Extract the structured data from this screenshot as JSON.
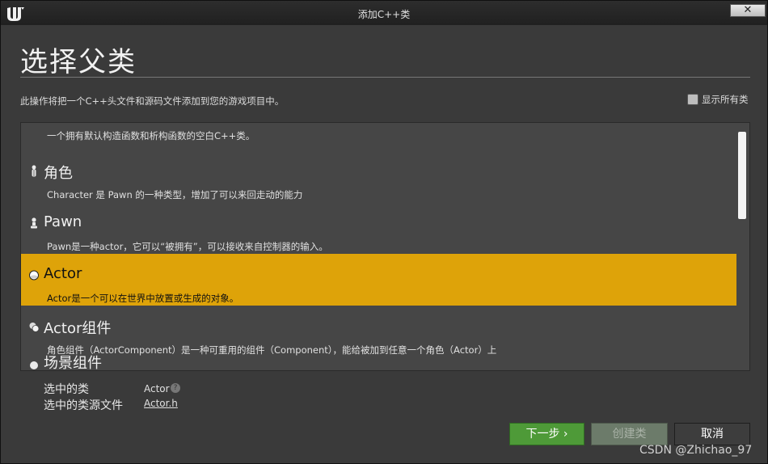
{
  "window": {
    "title": "添加C++类",
    "close_label": "✕"
  },
  "heading": "选择父类",
  "description": "此操作将把一个C++头文件和源码文件添加到您的游戏项目中。",
  "show_all": {
    "label": "显示所有类",
    "checked": false
  },
  "list": {
    "top_partial_desc": "一个拥有默认构造函数和析构函数的空白C++类。",
    "items": [
      {
        "name": "角色",
        "desc": "Character 是 Pawn 的一种类型，增加了可以来回走动的能力",
        "icon": "character-icon",
        "selected": false
      },
      {
        "name": "Pawn",
        "desc": "Pawn是一种actor，它可以“被拥有”，可以接收来自控制器的输入。",
        "icon": "pawn-icon",
        "selected": false
      },
      {
        "name": "Actor",
        "desc": "Actor是一个可以在世界中放置或生成的对象。",
        "icon": "actor-icon",
        "selected": true
      },
      {
        "name": "Actor组件",
        "desc": "角色组件（ActorComponent）是一种可重用的组件（Component），能给被加到任意一个角色（Actor）上",
        "icon": "actor-component-icon",
        "selected": false
      }
    ],
    "cut_item_name": "场景组件"
  },
  "selected_info": {
    "class_label": "选中的类",
    "class_value": "Actor",
    "source_label": "选中的类源文件",
    "source_value": "Actor.h"
  },
  "buttons": {
    "next": "下一步 ›",
    "create": "创建类",
    "cancel": "取消"
  },
  "watermark": "CSDN @Zhichao_97",
  "colors": {
    "selected": "#dea309",
    "next_button": "#4e9a38"
  }
}
